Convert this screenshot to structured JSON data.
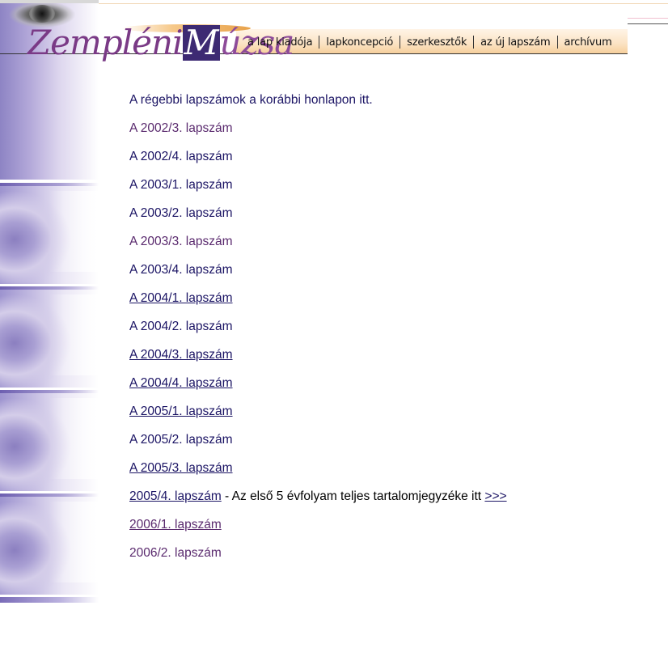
{
  "header": {
    "logo": {
      "part1": "Zempléni",
      "part2": "M",
      "part3": "úzsa"
    },
    "nav": [
      {
        "label": "a lap kiadója"
      },
      {
        "label": "lapkoncepció"
      },
      {
        "label": "szerkesztők"
      },
      {
        "label": "az új lapszám"
      },
      {
        "label": "archívum"
      }
    ]
  },
  "content": {
    "intro": "A régebbi lapszámok a korábbi honlapon itt.",
    "issues": [
      {
        "label": "A 2002/3. lapszám",
        "style": "visited"
      },
      {
        "label": "A 2002/4. lapszám",
        "style": "plain"
      },
      {
        "label": "A 2003/1. lapszám",
        "style": "plain"
      },
      {
        "label": "A 2003/2. lapszám",
        "style": "plain"
      },
      {
        "label": "A 2003/3. lapszám",
        "style": "visited"
      },
      {
        "label": "A 2003/4. lapszám",
        "style": "plain"
      },
      {
        "label": "A 2004/1. lapszám",
        "style": "link"
      },
      {
        "label": "A 2004/2. lapszám",
        "style": "plain"
      },
      {
        "label": "A 2004/3. lapszám",
        "style": "link"
      },
      {
        "label": "A 2004/4. lapszám",
        "style": "link"
      },
      {
        "label": "A 2005/1. lapszám",
        "style": "link"
      },
      {
        "label": "A 2005/2. lapszám",
        "style": "plain"
      },
      {
        "label": "A 2005/3. lapszám",
        "style": "link"
      }
    ],
    "row_2005_4": {
      "link": "2005/4. lapszám",
      "text": " - Az első 5 évfolyam teljes tartalomjegyzéke itt ",
      "arrow": ">>>"
    },
    "row_2006_1": "2006/1. lapszám",
    "row_2006_2": "2006/2. lapszám"
  },
  "colors": {
    "link": "#1b1464",
    "visited": "#5a2a6e",
    "accent": "#3d2a73"
  }
}
